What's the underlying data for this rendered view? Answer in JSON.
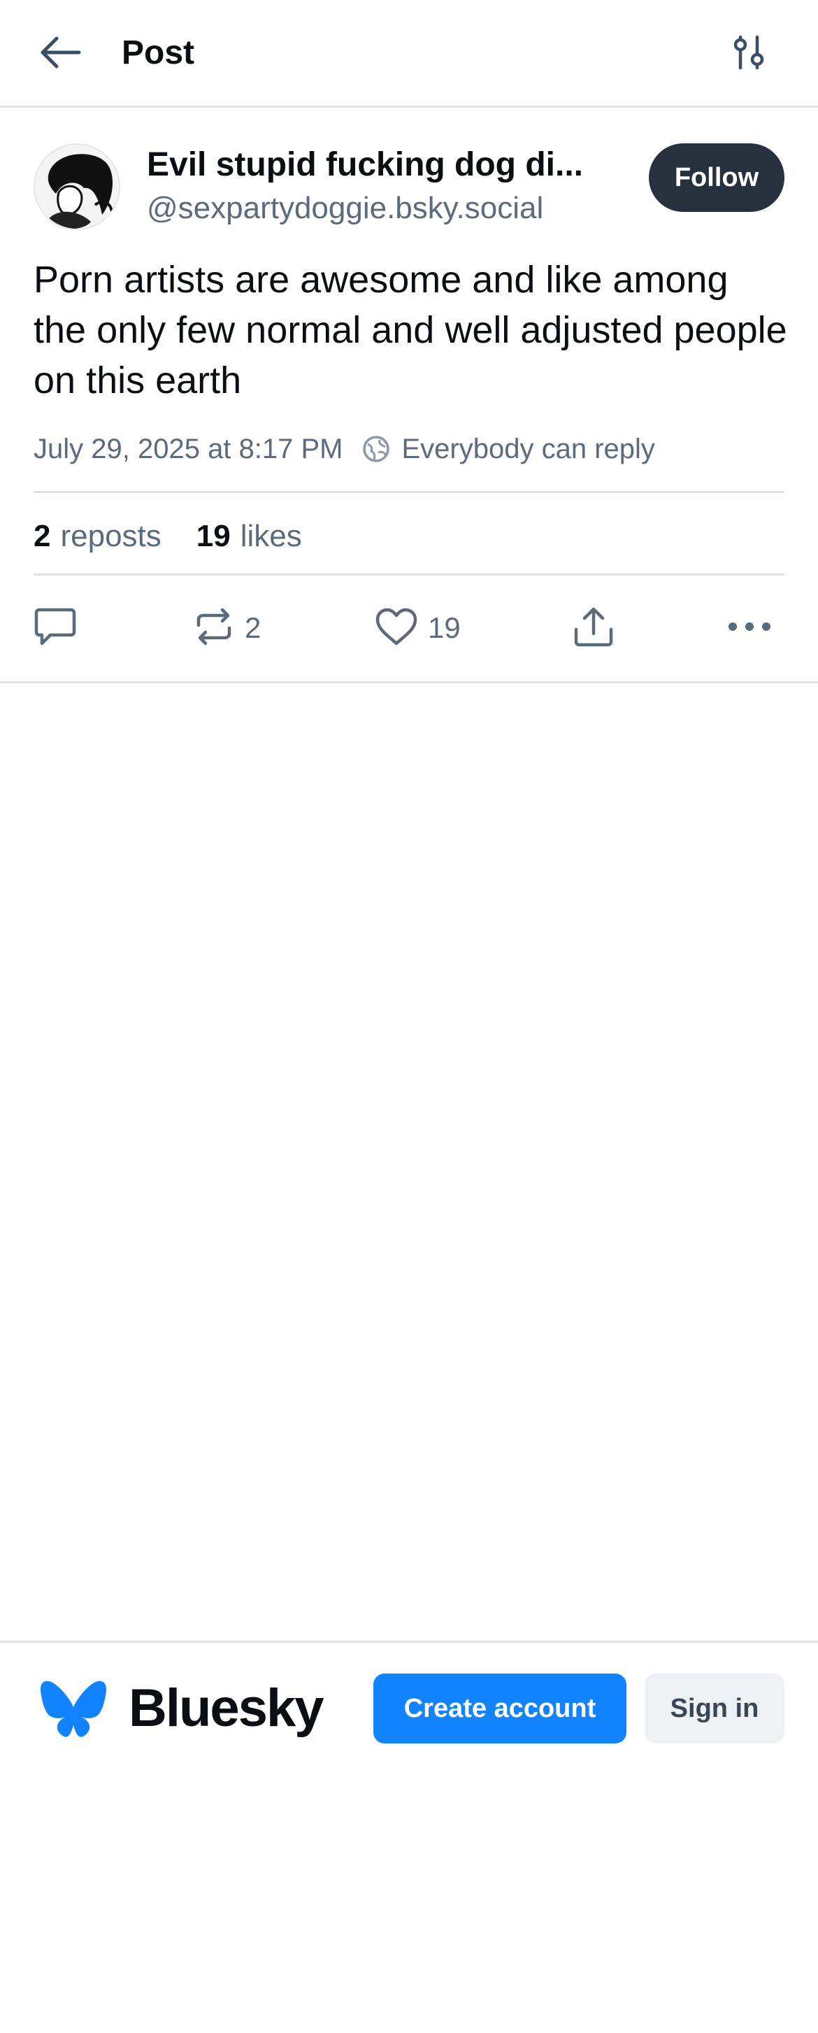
{
  "header": {
    "title": "Post",
    "back_icon": "arrow-left-icon",
    "filter_icon": "sliders-icon"
  },
  "post": {
    "author": {
      "display_name": "Evil stupid fucking dog di...",
      "handle": "@sexpartydoggie.bsky.social"
    },
    "follow_label": "Follow",
    "text": "Porn artists are awesome and like among the only few normal and well adjusted people on this earth",
    "timestamp": "July 29, 2025 at 8:17 PM",
    "reply_setting": "Everybody can reply",
    "stats": {
      "reposts_count": "2",
      "reposts_label": "reposts",
      "likes_count": "19",
      "likes_label": "likes"
    },
    "actions": {
      "reply_count": "",
      "repost_count": "2",
      "like_count": "19"
    }
  },
  "bottom_bar": {
    "brand": "Bluesky",
    "create_account_label": "Create account",
    "sign_in_label": "Sign in"
  },
  "colors": {
    "accent": "#1183fe",
    "follow_bg": "#27303d",
    "muted_text": "#5b6b7c",
    "divider": "#dfe3e8"
  }
}
